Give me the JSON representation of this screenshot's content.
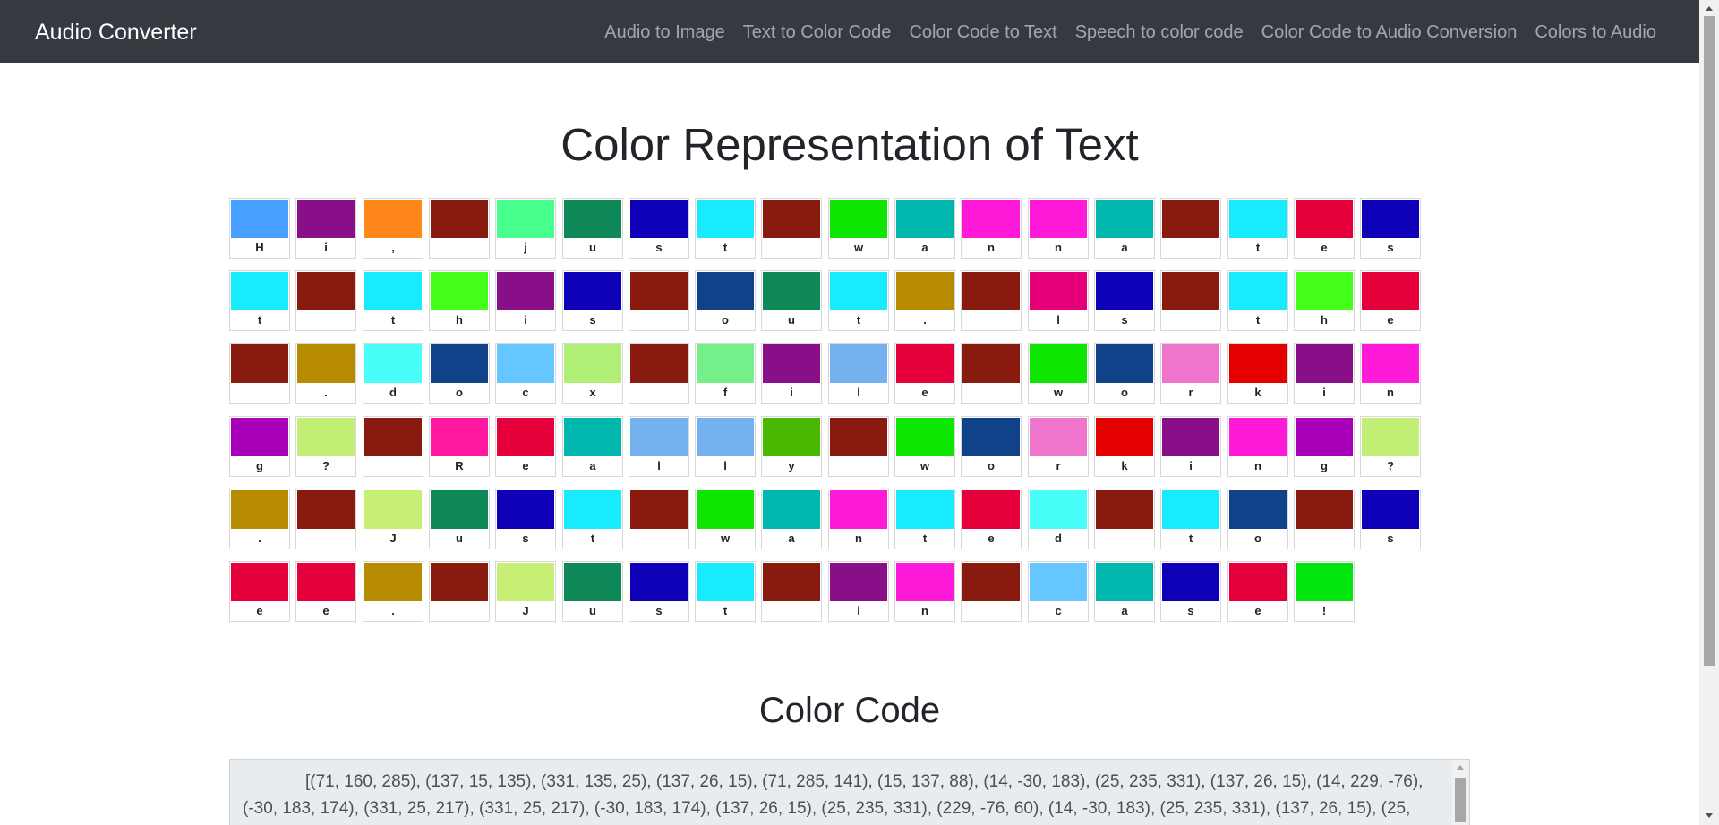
{
  "navbar": {
    "brand": "Audio Converter",
    "links": [
      "Audio to Image",
      "Text to Color Code",
      "Color Code to Text",
      "Speech to color code",
      "Color Code to Audio Conversion",
      "Colors to Audio"
    ]
  },
  "main": {
    "title": "Color Representation of Text",
    "cells": [
      {
        "char": "H",
        "color": "#47a0ff"
      },
      {
        "char": "i",
        "color": "#880f87"
      },
      {
        "char": ",",
        "color": "#ff8719"
      },
      {
        "char": "",
        "color": "#891a0f"
      },
      {
        "char": "j",
        "color": "#47ff8d"
      },
      {
        "char": "u",
        "color": "#0f8958"
      },
      {
        "char": "s",
        "color": "#0e00b7"
      },
      {
        "char": "t",
        "color": "#19ebff"
      },
      {
        "char": "",
        "color": "#891a0f"
      },
      {
        "char": "w",
        "color": "#0ee500"
      },
      {
        "char": "a",
        "color": "#00b7ae"
      },
      {
        "char": "n",
        "color": "#ff19d9"
      },
      {
        "char": "n",
        "color": "#ff19d9"
      },
      {
        "char": "a",
        "color": "#00b7ae"
      },
      {
        "char": "",
        "color": "#891a0f"
      },
      {
        "char": "t",
        "color": "#19ebff"
      },
      {
        "char": "e",
        "color": "#e5003c"
      },
      {
        "char": "s",
        "color": "#0e00b7"
      },
      {
        "char": "t",
        "color": "#19ebff"
      },
      {
        "char": "",
        "color": "#891a0f"
      },
      {
        "char": "t",
        "color": "#19ebff"
      },
      {
        "char": "h",
        "color": "#43ff19"
      },
      {
        "char": "i",
        "color": "#880f87"
      },
      {
        "char": "s",
        "color": "#0e00b7"
      },
      {
        "char": "",
        "color": "#891a0f"
      },
      {
        "char": "o",
        "color": "#0f4289"
      },
      {
        "char": "u",
        "color": "#0f8958"
      },
      {
        "char": "t",
        "color": "#19ebff"
      },
      {
        "char": ".",
        "color": "#b78b00"
      },
      {
        "char": "",
        "color": "#891a0f"
      },
      {
        "char": "l",
        "color": "#e5007a"
      },
      {
        "char": "s",
        "color": "#0e00b7"
      },
      {
        "char": "",
        "color": "#891a0f"
      },
      {
        "char": "t",
        "color": "#19ebff"
      },
      {
        "char": "h",
        "color": "#43ff19"
      },
      {
        "char": "e",
        "color": "#e5003c"
      },
      {
        "char": "",
        "color": "#891a0f"
      },
      {
        "char": ".",
        "color": "#b78b00"
      },
      {
        "char": "d",
        "color": "#47fff8"
      },
      {
        "char": "o",
        "color": "#0f4289"
      },
      {
        "char": "c",
        "color": "#66c6ff"
      },
      {
        "char": "x",
        "color": "#b0ef75"
      },
      {
        "char": "",
        "color": "#891a0f"
      },
      {
        "char": "f",
        "color": "#75ef89"
      },
      {
        "char": "i",
        "color": "#880f87"
      },
      {
        "char": "l",
        "color": "#75b0ef"
      },
      {
        "char": "e",
        "color": "#e5003c"
      },
      {
        "char": "",
        "color": "#891a0f"
      },
      {
        "char": "w",
        "color": "#0ee500"
      },
      {
        "char": "o",
        "color": "#0f4289"
      },
      {
        "char": "r",
        "color": "#ef75cd"
      },
      {
        "char": "k",
        "color": "#e50000"
      },
      {
        "char": "i",
        "color": "#880f87"
      },
      {
        "char": "n",
        "color": "#ff19d9"
      },
      {
        "char": "g",
        "color": "#a700b7"
      },
      {
        "char": "?",
        "color": "#c1ef75"
      },
      {
        "char": "",
        "color": "#891a0f"
      },
      {
        "char": "R",
        "color": "#ff19a0"
      },
      {
        "char": "e",
        "color": "#e5003c"
      },
      {
        "char": "a",
        "color": "#00b7ae"
      },
      {
        "char": "l",
        "color": "#75b0ef"
      },
      {
        "char": "l",
        "color": "#75b0ef"
      },
      {
        "char": "y",
        "color": "#4ab700"
      },
      {
        "char": "",
        "color": "#891a0f"
      },
      {
        "char": "w",
        "color": "#0ee500"
      },
      {
        "char": "o",
        "color": "#0f4289"
      },
      {
        "char": "r",
        "color": "#ef75cd"
      },
      {
        "char": "k",
        "color": "#e50000"
      },
      {
        "char": "i",
        "color": "#880f87"
      },
      {
        "char": "n",
        "color": "#ff19d9"
      },
      {
        "char": "g",
        "color": "#a700b7"
      },
      {
        "char": "?",
        "color": "#c1ef75"
      },
      {
        "char": ".",
        "color": "#b78b00"
      },
      {
        "char": "",
        "color": "#891a0f"
      },
      {
        "char": "J",
        "color": "#c8ef75"
      },
      {
        "char": "u",
        "color": "#0f8958"
      },
      {
        "char": "s",
        "color": "#0e00b7"
      },
      {
        "char": "t",
        "color": "#19ebff"
      },
      {
        "char": "",
        "color": "#891a0f"
      },
      {
        "char": "w",
        "color": "#0ee500"
      },
      {
        "char": "a",
        "color": "#00b7ae"
      },
      {
        "char": "n",
        "color": "#ff19d9"
      },
      {
        "char": "t",
        "color": "#19ebff"
      },
      {
        "char": "e",
        "color": "#e5003c"
      },
      {
        "char": "d",
        "color": "#47fff8"
      },
      {
        "char": "",
        "color": "#891a0f"
      },
      {
        "char": "t",
        "color": "#19ebff"
      },
      {
        "char": "o",
        "color": "#0f4289"
      },
      {
        "char": "",
        "color": "#891a0f"
      },
      {
        "char": "s",
        "color": "#0e00b7"
      },
      {
        "char": "e",
        "color": "#e5003c"
      },
      {
        "char": "e",
        "color": "#e5003c"
      },
      {
        "char": ".",
        "color": "#b78b00"
      },
      {
        "char": "",
        "color": "#891a0f"
      },
      {
        "char": "J",
        "color": "#c8ef75"
      },
      {
        "char": "u",
        "color": "#0f8958"
      },
      {
        "char": "s",
        "color": "#0e00b7"
      },
      {
        "char": "t",
        "color": "#19ebff"
      },
      {
        "char": "",
        "color": "#891a0f"
      },
      {
        "char": "i",
        "color": "#880f87"
      },
      {
        "char": "n",
        "color": "#ff19d9"
      },
      {
        "char": "",
        "color": "#891a0f"
      },
      {
        "char": "c",
        "color": "#66c6ff"
      },
      {
        "char": "a",
        "color": "#00b7ae"
      },
      {
        "char": "s",
        "color": "#0e00b7"
      },
      {
        "char": "e",
        "color": "#e5003c"
      },
      {
        "char": "!",
        "color": "#00e50e"
      }
    ],
    "color_code_title": "Color Code",
    "color_code_text": "[(71, 160, 285), (137, 15, 135), (331, 135, 25), (137, 26, 15), (71, 285, 141), (15, 137, 88), (14, -30, 183), (25, 235, 331), (137, 26, 15), (14, 229, -76), (-30, 183, 174), (331, 25, 217), (331, 25, 217), (-30, 183, 174), (137, 26, 15), (25, 235, 331), (229, -76, 60), (14, -30, 183), (25, 235, 331), (137, 26, 15), (25,"
  }
}
